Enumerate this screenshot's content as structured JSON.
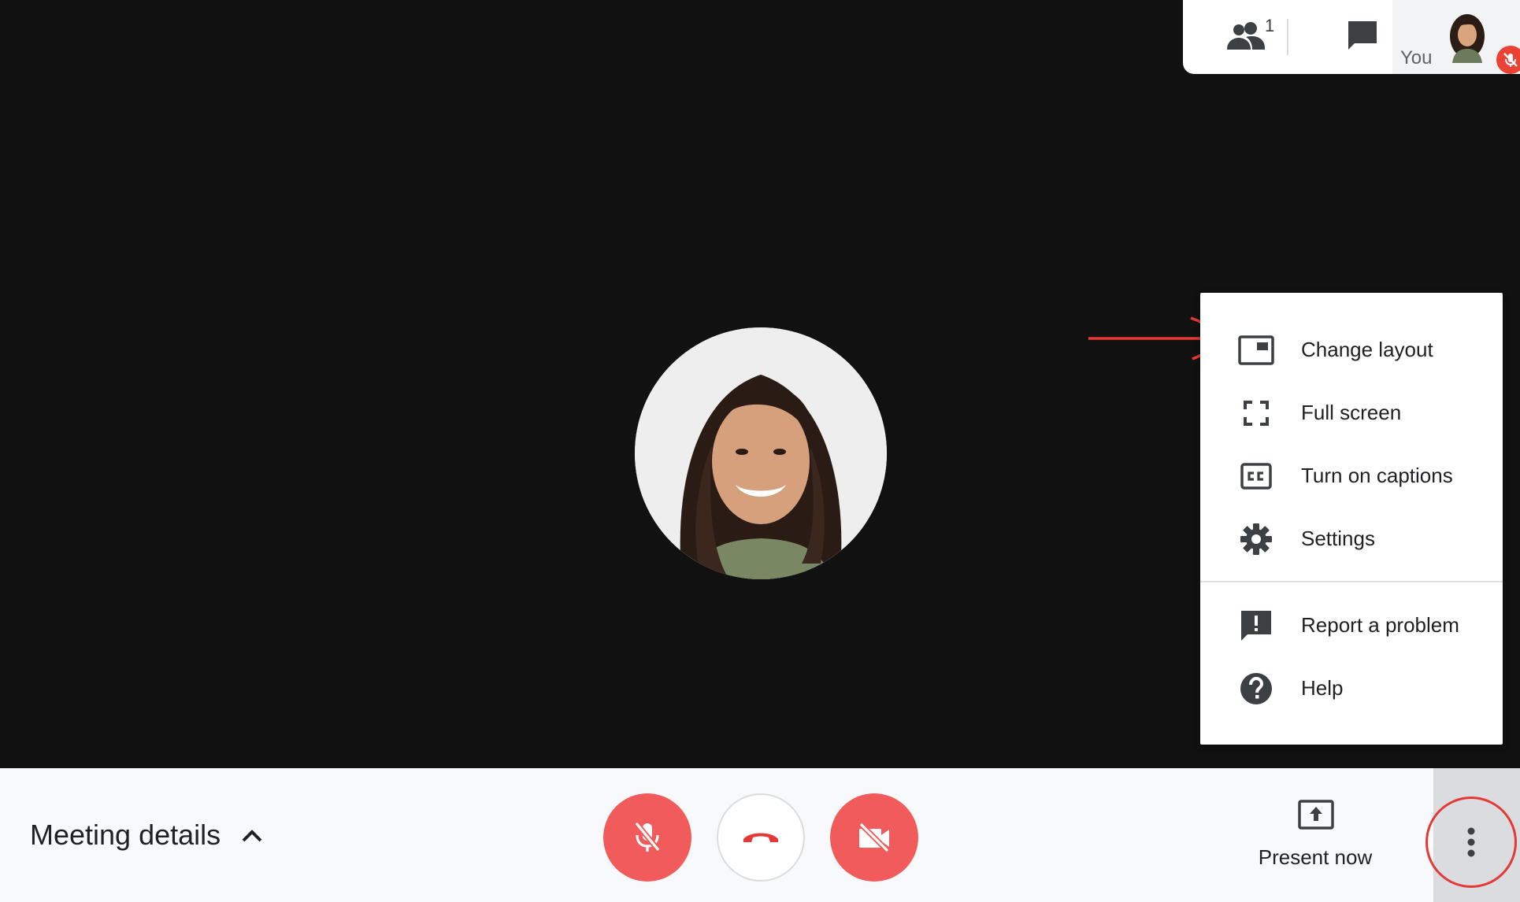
{
  "topbar": {
    "participant_count": "1",
    "self_label": "You",
    "icons": [
      "people-icon",
      "chat-icon",
      "mic-off-icon"
    ]
  },
  "menu": {
    "items": [
      {
        "label": "Change layout",
        "icon": "change-layout-icon"
      },
      {
        "label": "Full screen",
        "icon": "fullscreen-icon"
      },
      {
        "label": "Turn on captions",
        "icon": "captions-icon"
      },
      {
        "label": "Settings",
        "icon": "gear-icon"
      },
      {
        "label": "Report a problem",
        "icon": "report-problem-icon"
      },
      {
        "label": "Help",
        "icon": "help-icon"
      }
    ]
  },
  "bottombar": {
    "meeting_details_label": "Meeting details",
    "present_now_label": "Present now",
    "icons": [
      "chevron-up-icon",
      "mic-off-icon",
      "hangup-icon",
      "camera-off-icon",
      "present-icon",
      "more-vert-icon"
    ]
  },
  "colors": {
    "stage_bg": "#111111",
    "control_red": "#f15b5b",
    "annotation_red": "#e53935",
    "icon_gray": "#3c4043"
  }
}
